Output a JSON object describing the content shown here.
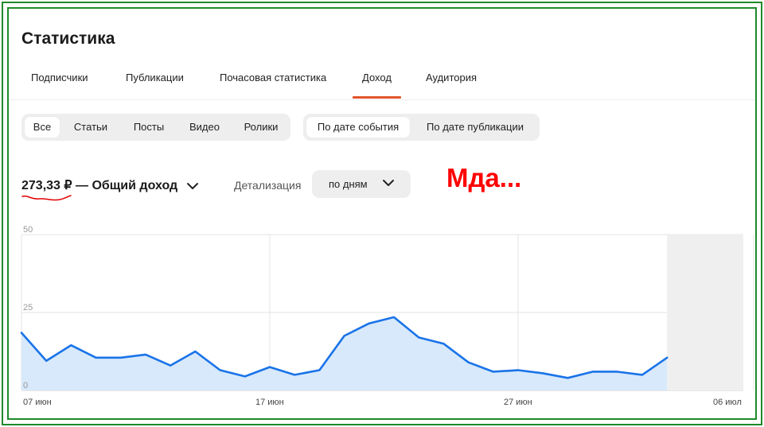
{
  "page": {
    "title": "Статистика"
  },
  "tabs": [
    {
      "label": "Подписчики",
      "active": false
    },
    {
      "label": "Публикации",
      "active": false
    },
    {
      "label": "Почасовая статистика",
      "active": false
    },
    {
      "label": "Доход",
      "active": true
    },
    {
      "label": "Аудитория",
      "active": false
    }
  ],
  "content_filter": {
    "options": [
      "Все",
      "Статьи",
      "Посты",
      "Видео",
      "Ролики"
    ],
    "selected": "Все"
  },
  "date_filter": {
    "options": [
      "По дате события",
      "По дате публикации"
    ],
    "selected": "По дате события"
  },
  "income": {
    "amount": "273,33 ₽",
    "label": "— Общий доход"
  },
  "detail": {
    "label": "Детализация",
    "value": "по дням"
  },
  "annotation": {
    "text": "Мда...",
    "color": "#ff0000"
  },
  "colors": {
    "accent": "#e2542a",
    "line": "#1a73e8",
    "area": "#d7e9fb",
    "frame": "#1e8a2a"
  },
  "chart_data": {
    "type": "area",
    "y_ticks": [
      "50",
      "25",
      "0"
    ],
    "ylim": [
      0,
      50
    ],
    "x_tick_labels": [
      "07 июн",
      "17 июн",
      "27 июн",
      "06 июл"
    ],
    "x": [
      "07 июн",
      "08 июн",
      "09 июн",
      "10 июн",
      "11 июн",
      "12 июн",
      "13 июн",
      "14 июн",
      "15 июн",
      "16 июн",
      "17 июн",
      "18 июн",
      "19 июн",
      "20 июн",
      "21 июн",
      "22 июн",
      "23 июн",
      "24 июн",
      "25 июн",
      "26 июн",
      "27 июн",
      "28 июн",
      "29 июн",
      "30 июн",
      "01 июл",
      "02 июл",
      "03 июл"
    ],
    "values": [
      18.5,
      9.5,
      14.5,
      10.5,
      10.5,
      11.5,
      8,
      12.5,
      6.5,
      4.5,
      7.5,
      5,
      6.5,
      17.5,
      21.5,
      23.5,
      17,
      15,
      9,
      6,
      6.5,
      5.5,
      4,
      6,
      6,
      5,
      10.5
    ],
    "grid": true,
    "shaded_region_from": "04 июл"
  }
}
